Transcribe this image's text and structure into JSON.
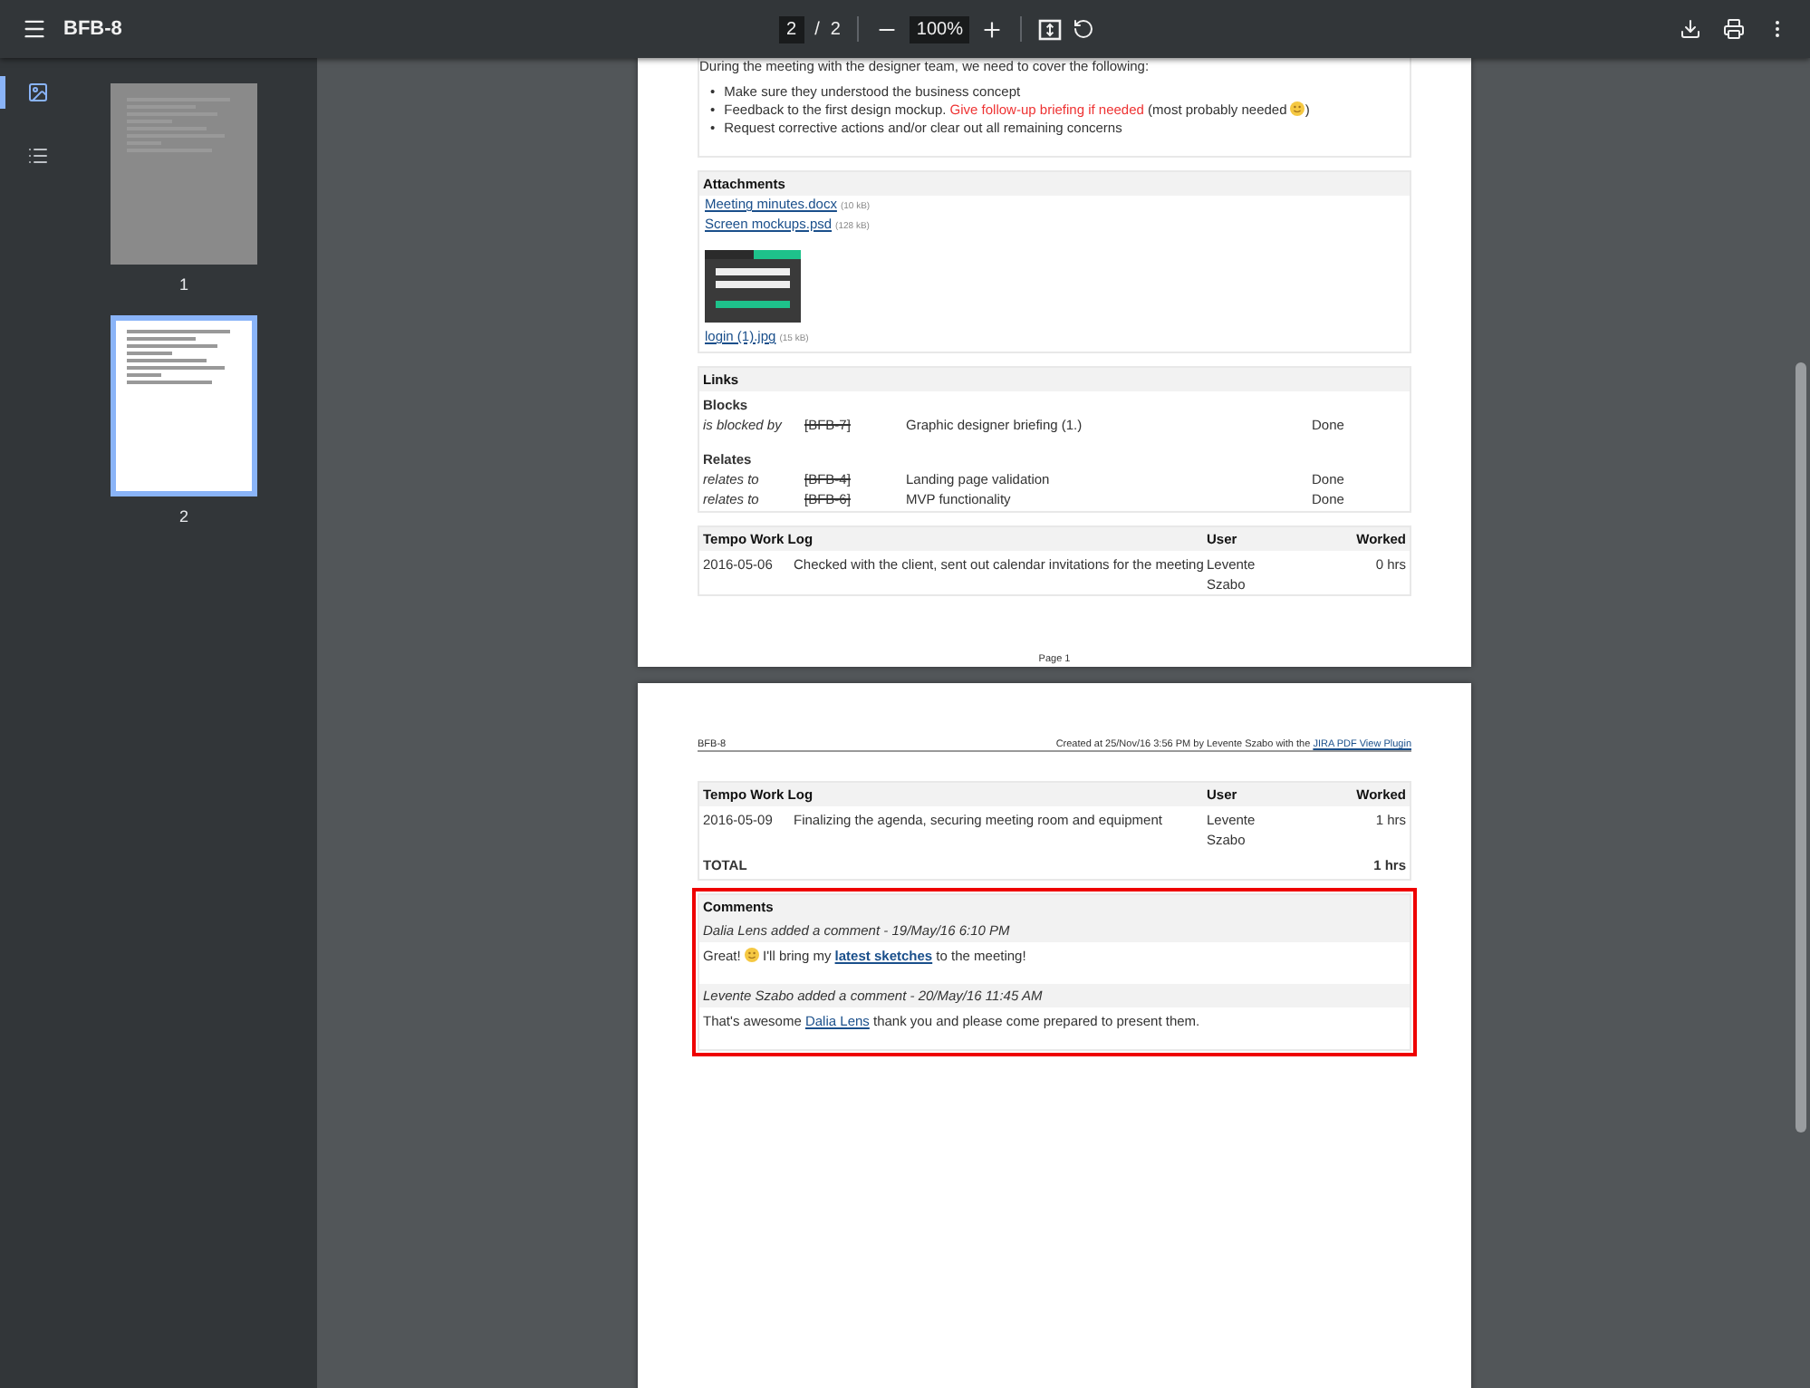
{
  "toolbar": {
    "title": "BFB-8",
    "page_current": "2",
    "page_separator": "/",
    "page_total": "2",
    "zoom": "100%"
  },
  "sidebar": {
    "tabs": [
      {
        "kind": "thumbnails",
        "selected": true
      },
      {
        "kind": "outline",
        "selected": false
      }
    ],
    "thumbnails": [
      {
        "label": "1",
        "selected": false
      },
      {
        "label": "2",
        "selected": true
      }
    ]
  },
  "page_1": {
    "intro": "During the meeting with the designer team, we need to cover the following:",
    "bullets": [
      {
        "marker": "•",
        "segments": [
          {
            "kind": "text",
            "text": "Make sure they understood the business concept"
          }
        ]
      },
      {
        "marker": "•",
        "segments": [
          {
            "kind": "text",
            "text": "Feedback to the first design mockup. "
          },
          {
            "kind": "highlight",
            "text": "Give follow-up briefing if needed"
          },
          {
            "kind": "text",
            "text": " (most probably needed "
          },
          {
            "kind": "emoji"
          },
          {
            "kind": "text",
            "text": ")"
          }
        ]
      },
      {
        "marker": "•",
        "segments": [
          {
            "kind": "text",
            "text": "Request corrective actions and/or clear out all remaining concerns"
          }
        ]
      }
    ],
    "attachments": {
      "title": "Attachments",
      "files": [
        {
          "name": "Meeting minutes.docx",
          "size": "(10 kB)"
        },
        {
          "name": "Screen mockups.psd",
          "size": "(128 kB)"
        }
      ],
      "image": {
        "name": "login (1).jpg",
        "size": "(15 kB)"
      }
    },
    "links": {
      "title": "Links",
      "groups": [
        {
          "title": "Blocks",
          "items": [
            {
              "relation": "is blocked by",
              "key": "[BFB-7]",
              "resolved": true,
              "summary": "Graphic designer briefing (1.)",
              "status": "Done"
            }
          ]
        },
        {
          "title": "Relates",
          "items": [
            {
              "relation": "relates to",
              "key": "[BFB-4]",
              "resolved": true,
              "summary": "Landing page validation",
              "status": "Done"
            },
            {
              "relation": "relates to",
              "key": "[BFB-6]",
              "resolved": true,
              "summary": "MVP functionality",
              "status": "Done"
            }
          ]
        }
      ]
    },
    "worklog": {
      "columns": [
        "Tempo Work Log",
        "User",
        "Worked"
      ],
      "rows": [
        {
          "date": "2016-05-06",
          "description": "Checked with the client, sent out calendar invitations for the meeting",
          "user": "Levente Szabo",
          "worked": "0 hrs"
        }
      ]
    },
    "footer": "Page 1"
  },
  "page_2": {
    "header_left": "BFB-8",
    "header_text": "Created at 25/Nov/16 3:56 PM by Levente Szabo with the",
    "header_link": "JIRA PDF View Plugin",
    "worklog": {
      "columns": [
        "Tempo Work Log",
        "User",
        "Worked"
      ],
      "rows": [
        {
          "date": "2016-05-09",
          "description": "Finalizing the agenda, securing meeting room and equipment",
          "user": "Levente Szabo",
          "worked": "1 hrs"
        }
      ],
      "total": {
        "label": "TOTAL",
        "value": "1 hrs"
      }
    },
    "comments": {
      "title": "Comments",
      "highlighted": true,
      "items": [
        {
          "meta": "Dalia Lens added a comment - 19/May/16 6:10 PM",
          "body": [
            {
              "kind": "text",
              "text": "Great! "
            },
            {
              "kind": "emoji"
            },
            {
              "kind": "text",
              "text": " I'll bring my "
            },
            {
              "kind": "link",
              "text": "latest sketches"
            },
            {
              "kind": "text",
              "text": " to the meeting!"
            }
          ]
        },
        {
          "meta": "Levente Szabo added a comment - 20/May/16 11:45 AM",
          "body": [
            {
              "kind": "text",
              "text": "That's awesome "
            },
            {
              "kind": "mention",
              "text": "Dalia Lens"
            },
            {
              "kind": "text",
              "text": " thank you and please come prepared to present them."
            }
          ]
        }
      ]
    }
  }
}
